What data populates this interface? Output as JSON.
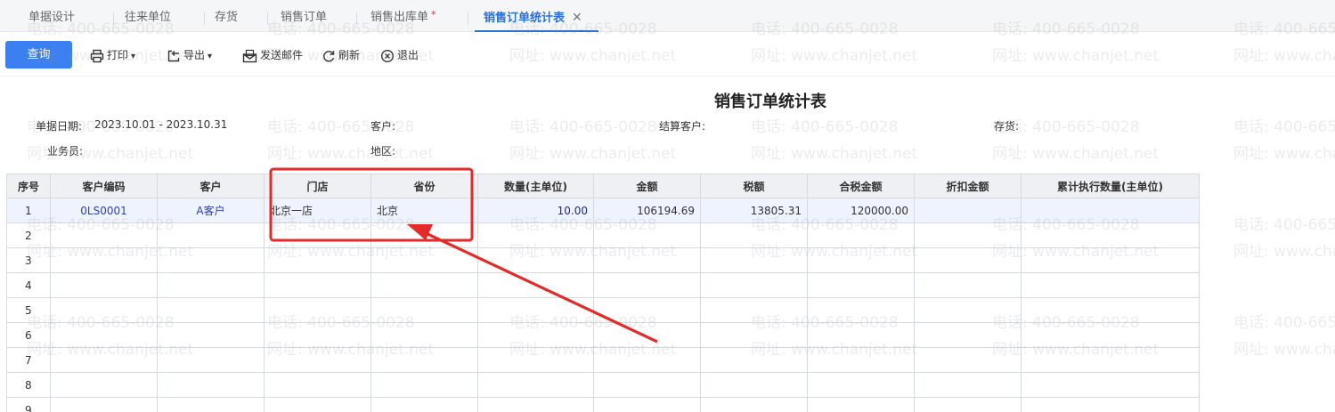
{
  "tabs": [
    {
      "label": "单据设计",
      "active": false,
      "dirty": false
    },
    {
      "label": "往来单位",
      "active": false,
      "dirty": false
    },
    {
      "label": "存货",
      "active": false,
      "dirty": false
    },
    {
      "label": "销售订单",
      "active": false,
      "dirty": false
    },
    {
      "label": "销售出库单",
      "active": false,
      "dirty": true,
      "dirty_mark": "*"
    },
    {
      "label": "销售订单统计表",
      "active": true,
      "dirty": false,
      "close": "✕"
    }
  ],
  "toolbar": {
    "query": "查询",
    "print": "打印",
    "export": "导出",
    "email": "发送邮件",
    "refresh": "刷新",
    "exit": "退出"
  },
  "report": {
    "title": "销售订单统计表",
    "filters": {
      "date_label": "单据日期:",
      "date_value": "2023.10.01 - 2023.10.31",
      "customer_label": "客户:",
      "settle_label": "结算客户:",
      "stock_label": "存货:",
      "salesman_label": "业务员:",
      "region_label": "地区:"
    }
  },
  "table": {
    "columns": [
      "序号",
      "客户编码",
      "客户",
      "门店",
      "省份",
      "数量(主单位)",
      "金额",
      "税额",
      "合税金额",
      "折扣金额",
      "累计执行数量(主单位)"
    ],
    "rows": [
      [
        "1",
        "0LS0001",
        "A客户",
        "北京一店",
        "北京",
        "10.00",
        "106194.69",
        "13805.31",
        "120000.00",
        "",
        ""
      ],
      [
        "2",
        "",
        "",
        "",
        "",
        "",
        "",
        "",
        "",
        "",
        ""
      ],
      [
        "3",
        "",
        "",
        "",
        "",
        "",
        "",
        "",
        "",
        "",
        ""
      ],
      [
        "4",
        "",
        "",
        "",
        "",
        "",
        "",
        "",
        "",
        "",
        ""
      ],
      [
        "5",
        "",
        "",
        "",
        "",
        "",
        "",
        "",
        "",
        "",
        ""
      ],
      [
        "6",
        "",
        "",
        "",
        "",
        "",
        "",
        "",
        "",
        "",
        ""
      ],
      [
        "7",
        "",
        "",
        "",
        "",
        "",
        "",
        "",
        "",
        "",
        ""
      ],
      [
        "8",
        "",
        "",
        "",
        "",
        "",
        "",
        "",
        "",
        "",
        ""
      ],
      [
        "9",
        "",
        "",
        "",
        "",
        "",
        "",
        "",
        "",
        "",
        ""
      ]
    ]
  },
  "watermark": {
    "phone": "电话: 400-665-0028",
    "site": "网址: www.chanjet.net"
  },
  "colors": {
    "accent": "#3b7ff0",
    "active_tab": "#2b6fd8",
    "annotation": "#e52a2a"
  },
  "icons": {
    "print": "printer-icon",
    "export": "export-icon",
    "email": "mail-icon",
    "refresh": "refresh-icon",
    "exit": "close-circle-icon"
  }
}
